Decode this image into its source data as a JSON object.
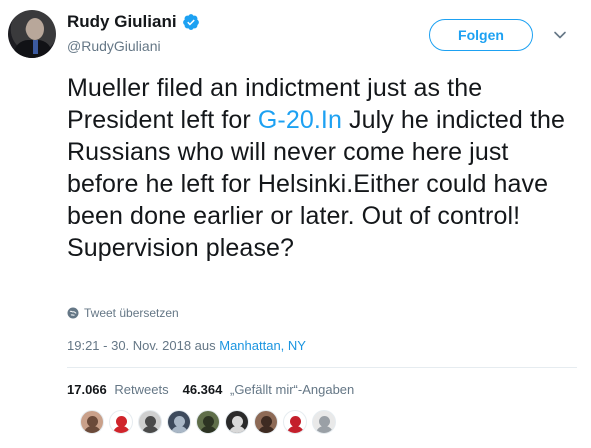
{
  "header": {
    "display_name": "Rudy Giuliani",
    "handle": "@RudyGiuliani",
    "follow_label": "Folgen"
  },
  "tweet": {
    "text_before": "Mueller filed an indictment just as the President left for ",
    "link_text": "G-20.In",
    "text_after": " July he indicted the Russians who will never come here just before he left for Helsinki.Either could have been done earlier or later. Out of control! Supervision please?",
    "translate_label": "Tweet übersetzen",
    "time": "19:21 - 30. Nov. 2018 aus ",
    "location": "Manhattan, NY"
  },
  "stats": {
    "retweets_count": "17.066",
    "retweets_label": "Retweets",
    "likes_count": "46.364",
    "likes_label": "„Gefällt mir“-Angaben"
  },
  "icons": {
    "verified": "verified-badge-icon",
    "caret": "chevron-down-icon",
    "translate": "globe-icon"
  },
  "colors": {
    "accent": "#1da1f2",
    "muted": "#657786",
    "text": "#14171a",
    "divider": "#e6ecf0"
  },
  "likers": [
    {
      "name": "liker-avatar-1",
      "bg": "#c9a08a",
      "fg": "#6b4a3a"
    },
    {
      "name": "liker-avatar-2",
      "bg": "#ffffff",
      "fg": "#d0242b"
    },
    {
      "name": "liker-avatar-3",
      "bg": "#cfcfcf",
      "fg": "#4a4a4a"
    },
    {
      "name": "liker-avatar-4",
      "bg": "#3d4a5c",
      "fg": "#a9b7c6"
    },
    {
      "name": "liker-avatar-5",
      "bg": "#5f6e4a",
      "fg": "#2c3323"
    },
    {
      "name": "liker-avatar-6",
      "bg": "#2a2a2a",
      "fg": "#d9d9d9"
    },
    {
      "name": "liker-avatar-7",
      "bg": "#8d6a56",
      "fg": "#3e2b22"
    },
    {
      "name": "liker-avatar-8",
      "bg": "#ffffff",
      "fg": "#c41f2b"
    },
    {
      "name": "liker-avatar-9",
      "bg": "#e9e9e9",
      "fg": "#9aa0a6"
    }
  ]
}
